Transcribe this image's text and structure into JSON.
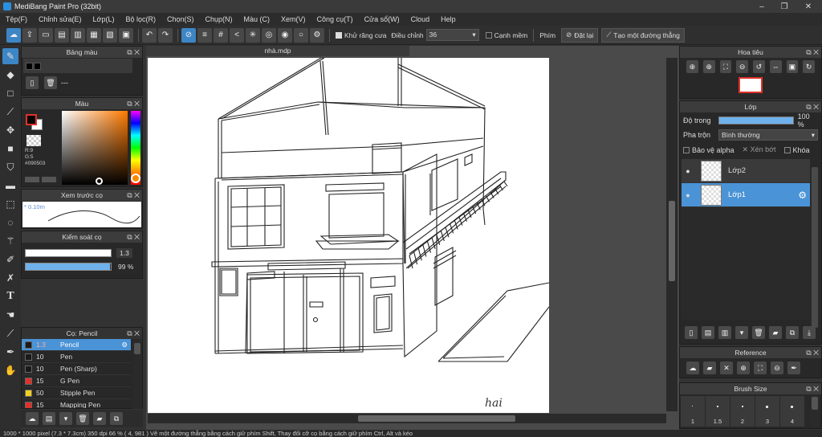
{
  "app": {
    "title": "MediBang Paint Pro (32bit)",
    "minimize": "–",
    "restore": "❐",
    "close": "✕"
  },
  "menu": [
    "Tệp(F)",
    "Chỉnh sửa(E)",
    "Lớp(L)",
    "Bộ lọc(R)",
    "Chọn(S)",
    "Chụp(N)",
    "Màu (C)",
    "Xem(V)",
    "Công cụ(T)",
    "Cửa sổ(W)",
    "Cloud",
    "Help"
  ],
  "toolbar": {
    "antialias_label": "Khử răng cưa",
    "adjust_label": "Điều chỉnh",
    "adjust_value": "36",
    "snap_label": "Cạnh mềm",
    "key_label": "Phím",
    "reset_label": "Đặt lại",
    "straight_line_label": "Tạo một đường thẳng"
  },
  "palette_panel": {
    "title": "Bảng màu",
    "value": "---"
  },
  "color_panel": {
    "title": "Màu",
    "r": "R:9",
    "g": "G:5",
    "hex": "#090503"
  },
  "brush_preview": {
    "title": "Xem trước cọ",
    "size": "* 0.10m"
  },
  "brush_control": {
    "title": "Kiểm soát cọ",
    "size": "1.3",
    "opacity": "99 %",
    "opacity_value": 0.99
  },
  "brush_list": {
    "title": "Cọ: Pencil",
    "items": [
      {
        "size": "1.3",
        "name": "Pencil",
        "color": "#1a1a1a",
        "selected": true
      },
      {
        "size": "10",
        "name": "Pen",
        "color": "#1a1a1a",
        "selected": false
      },
      {
        "size": "10",
        "name": "Pen (Sharp)",
        "color": "#1a1a1a",
        "selected": false
      },
      {
        "size": "15",
        "name": "G Pen",
        "color": "#e0312a",
        "selected": false
      },
      {
        "size": "50",
        "name": "Stipple Pen",
        "color": "#f0d020",
        "selected": false
      },
      {
        "size": "15",
        "name": "Mapping Pen",
        "color": "#e0312a",
        "selected": false
      }
    ]
  },
  "document": {
    "tab": "nhà.mdp",
    "signature": "hai"
  },
  "navigator": {
    "title": "Hoa tiêu"
  },
  "layer_panel": {
    "title": "Lớp",
    "opacity_label": "Độ trong",
    "opacity_value": "100 %",
    "opacity_fraction": 1.0,
    "blend_label": "Pha trộn",
    "blend_value": "Bình thường",
    "protect_alpha": "Bảo vệ alpha",
    "clipping": "Xén bớt",
    "lock": "Khóa",
    "layers": [
      {
        "name": "Lớp2",
        "selected": false
      },
      {
        "name": "Lớp1",
        "selected": true
      }
    ]
  },
  "reference": {
    "title": "Reference"
  },
  "brush_size": {
    "title": "Brush Size",
    "sizes": [
      "1",
      "1.5",
      "2",
      "3",
      "4"
    ]
  },
  "status": "1000 * 1000 pixel   (7.3 * 7.3cm)   350 dpi   66 %   ( 4, 981 )   Vẽ một đường thẳng bằng cách giữ phím Shift, Thay đổi cỡ cọ bằng cách giữ phím Ctrl, Alt và kéo",
  "colors": {
    "accent": "#4a93d6",
    "selected_tool": "#3d86c6",
    "fg_color": "#090503",
    "bg_color": "#ffffff"
  }
}
